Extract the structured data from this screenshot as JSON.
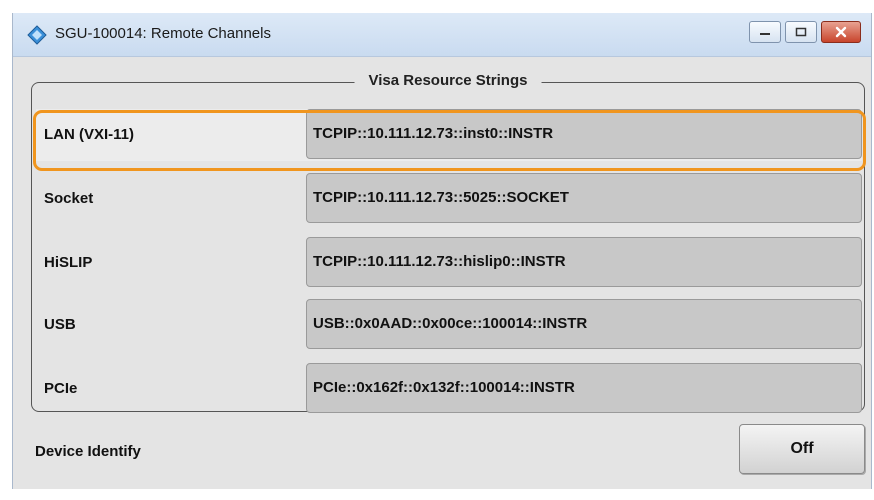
{
  "window": {
    "title": "SGU-100014: Remote Channels",
    "controls": {
      "minimize": "minimize",
      "maximize": "maximize",
      "close": "close"
    }
  },
  "group": {
    "title": "Visa Resource Strings",
    "rows": [
      {
        "label": "LAN (VXI-11)",
        "value": "TCPIP::10.111.12.73::inst0::INSTR",
        "highlighted": true
      },
      {
        "label": "Socket",
        "value": "TCPIP::10.111.12.73::5025::SOCKET"
      },
      {
        "label": "HiSLIP",
        "value": "TCPIP::10.111.12.73::hislip0::INSTR"
      },
      {
        "label": "USB",
        "value": "USB::0x0AAD::0x00ce::100014::INSTR"
      },
      {
        "label": "PCIe",
        "value": "PCIe::0x162f::0x132f::100014::INSTR"
      }
    ]
  },
  "device_identify": {
    "label": "Device Identify",
    "button_label": "Off"
  },
  "colors": {
    "highlight": "#f0951e",
    "field_bg": "#c8c8c8",
    "close_button": "#c8452c"
  },
  "icons": [
    "remote-channels-icon",
    "minimize-icon",
    "maximize-icon",
    "close-icon"
  ]
}
